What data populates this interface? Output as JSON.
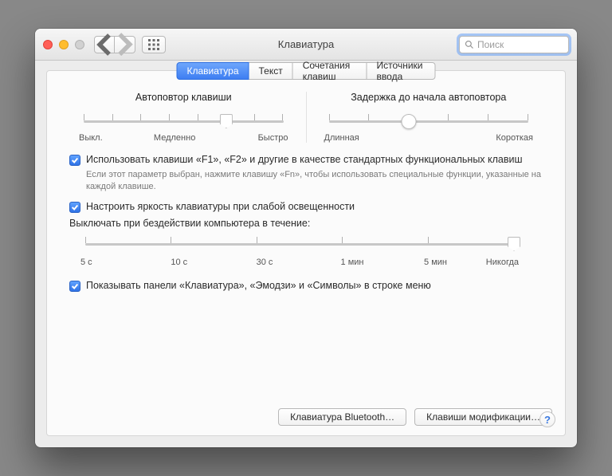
{
  "window": {
    "title": "Клавиатура"
  },
  "search": {
    "placeholder": "Поиск"
  },
  "tabs": [
    {
      "label": "Клавиатура",
      "active": true
    },
    {
      "label": "Текст"
    },
    {
      "label": "Сочетания клавиш"
    },
    {
      "label": "Источники ввода"
    }
  ],
  "key_repeat": {
    "title": "Автоповтор клавиши",
    "labels": {
      "off": "Выкл.",
      "slow": "Медленно",
      "fast": "Быстро"
    },
    "value": 5,
    "max": 7
  },
  "delay": {
    "title": "Задержка до начала автоповтора",
    "labels": {
      "long": "Длинная",
      "short": "Короткая"
    },
    "value": 2,
    "max": 5
  },
  "fn_keys": {
    "label": "Использовать клавиши «F1», «F2» и другие в качестве стандартных функциональных клавиш",
    "hint": "Если этот параметр выбран, нажмите клавишу «Fn», чтобы использовать специальные функции, указанные на каждой клавише."
  },
  "brightness": {
    "label": "Настроить яркость клавиатуры при слабой освещенности"
  },
  "inactivity": {
    "label": "Выключать при бездействии компьютера в течение:",
    "stops": [
      "5 с",
      "10 с",
      "30 с",
      "1 мин",
      "5 мин",
      "Никогда"
    ],
    "value": 5
  },
  "menubar_viewer": {
    "label": "Показывать панели «Клавиатура», «Эмодзи» и «Символы» в строке меню"
  },
  "buttons": {
    "bluetooth": "Клавиатура Bluetooth…",
    "modifiers": "Клавиши модификации…"
  },
  "help": "?"
}
